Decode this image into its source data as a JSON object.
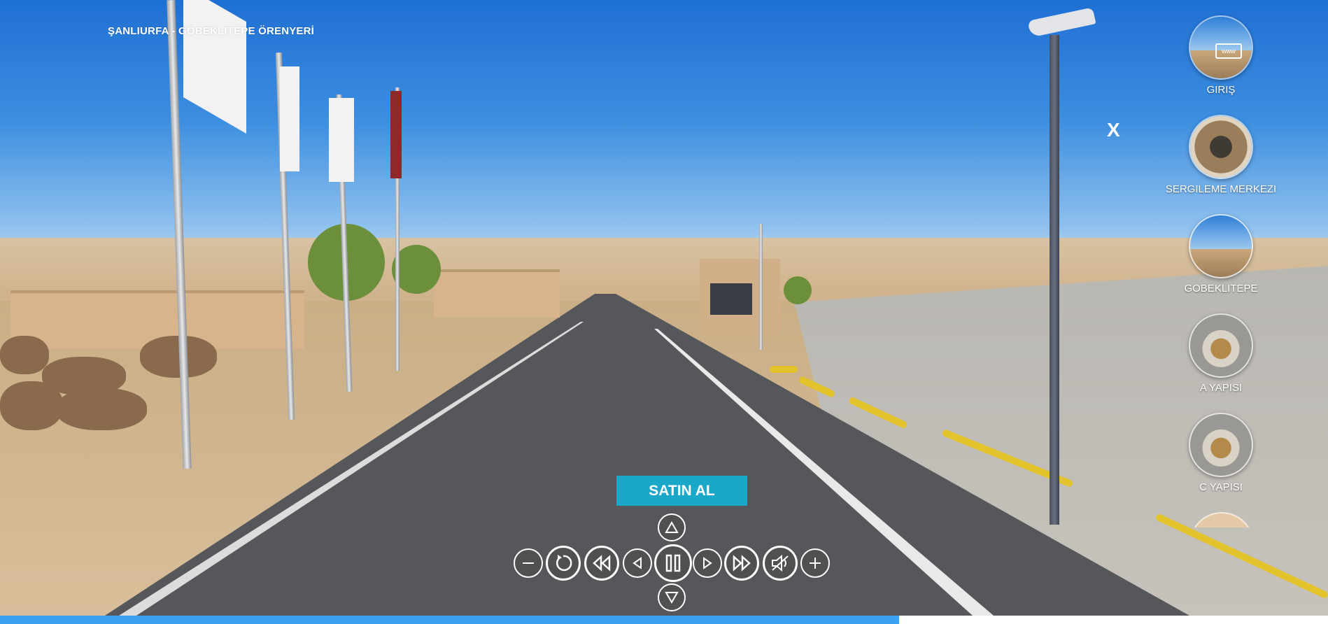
{
  "tour_title": "ŞANLIURFA - GÖBEKLİTEPE ÖRENYERİ",
  "close_label": "X",
  "buy_button_label": "SATIN AL",
  "scenes": [
    {
      "label": "GIRIŞ",
      "icon": "www-search-icon"
    },
    {
      "label": "SERGILEME MERKEZI",
      "icon": "exhibition-center-thumbnail"
    },
    {
      "label": "GOBEKLITEPE",
      "icon": "gobeklitepe-thumbnail"
    },
    {
      "label": "A YAPISI",
      "icon": "a-structure-thumbnail"
    },
    {
      "label": "C YAPISI",
      "icon": "c-structure-thumbnail"
    }
  ],
  "controls": [
    "zoom-out-icon",
    "rotate-icon",
    "rewind-icon",
    "pan-left-icon",
    "pause-icon",
    "pan-right-icon",
    "fast-forward-icon",
    "mute-icon",
    "zoom-in-icon",
    "pan-up-icon",
    "pan-down-icon"
  ],
  "progress": 0.677,
  "colors": {
    "accent": "#1aa7c8",
    "progress": "#3da1f2"
  }
}
